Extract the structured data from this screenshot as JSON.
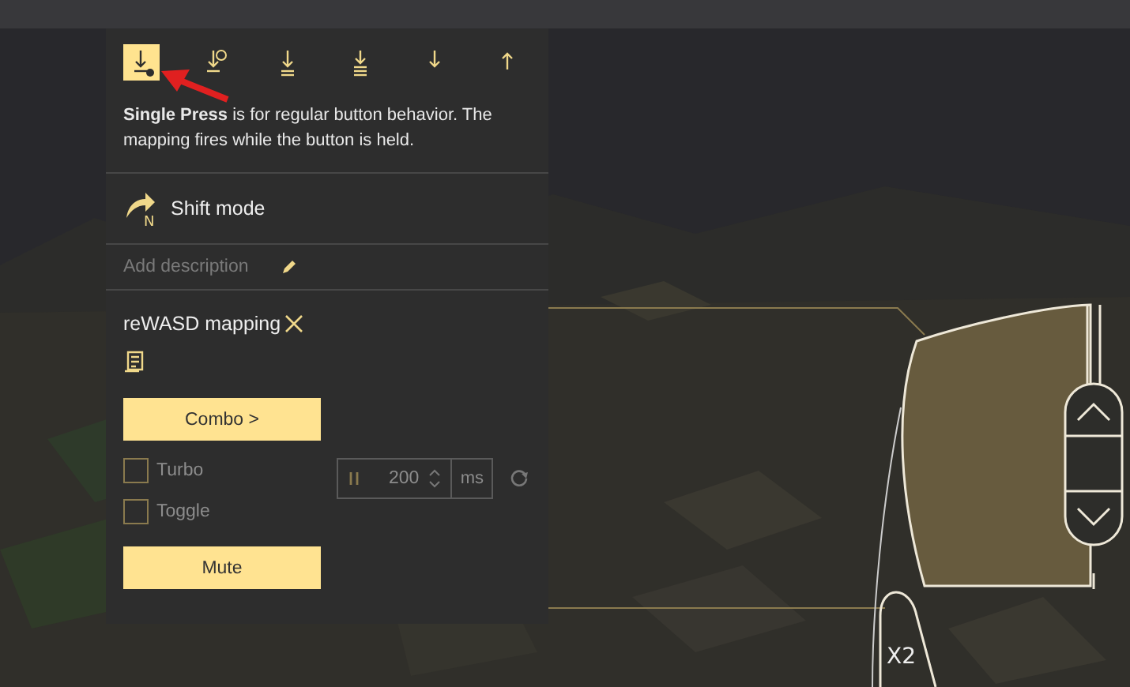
{
  "toolbar": [
    {
      "kind": "single-press",
      "selected": true
    },
    {
      "kind": "timed-press",
      "selected": false
    },
    {
      "kind": "double-press",
      "selected": false
    },
    {
      "kind": "triple-press",
      "selected": false
    },
    {
      "kind": "down",
      "selected": false
    },
    {
      "kind": "up",
      "selected": false
    }
  ],
  "description": "**Single Press** is for regular button behavior. The mapping fires while the button is held.",
  "shift_mode": {
    "label": "Shift mode",
    "badge": "N"
  },
  "add_description": {
    "placeholder": "Add description"
  },
  "mapping": {
    "title": "reWASD mapping",
    "combo_button": "Combo >",
    "options": [
      {
        "label": "Turbo",
        "checked": false
      },
      {
        "label": "Toggle",
        "checked": false
      }
    ],
    "turbo_field": {
      "value": "200",
      "unit": "ms"
    },
    "mute_button": "Mute"
  },
  "mouse": {
    "label": "X2"
  }
}
